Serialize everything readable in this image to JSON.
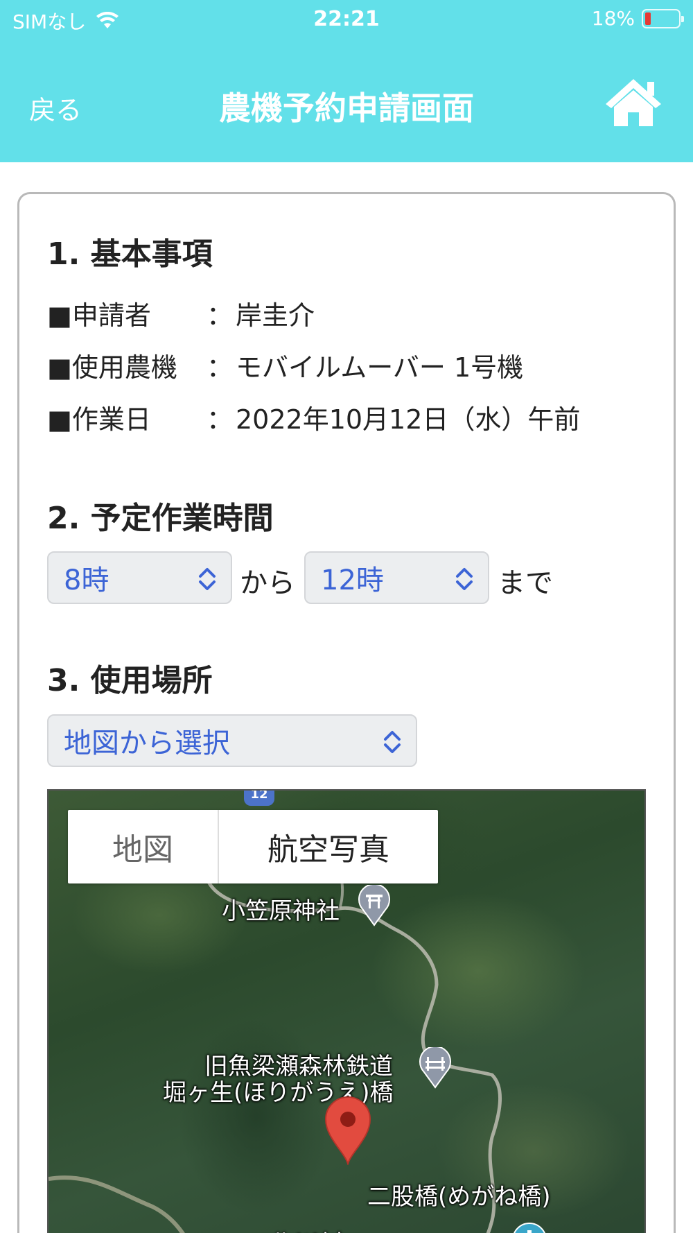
{
  "status_bar": {
    "carrier": "SIMなし",
    "time": "22:21",
    "battery_percent": "18%",
    "battery_level": 0.18,
    "battery_color": "#e53935"
  },
  "nav": {
    "back_label": "戻る",
    "title": "農機予約申請画面",
    "home_icon": "home-icon",
    "background_color": "#62e0e9"
  },
  "section1": {
    "title": "1. 基本事項",
    "rows": [
      {
        "label": "■申請者",
        "colon": "：",
        "value": "岸圭介"
      },
      {
        "label": "■使用農機",
        "colon": "：",
        "value": "モバイルムーバー 1号機"
      },
      {
        "label": "■作業日",
        "colon": "：",
        "value": "2022年10月12日（水）午前"
      }
    ]
  },
  "section2": {
    "title": "2. 予定作業時間",
    "start_select": "8時",
    "from_text": "から",
    "end_select": "12時",
    "until_text": "まで"
  },
  "section3": {
    "title": "3. 使用場所",
    "location_select": "地図から選択",
    "map": {
      "toggle_map": "地図",
      "toggle_aerial": "航空写真",
      "route_number": "12",
      "labels": {
        "shrine": "小笠原神社",
        "railway_line1": "旧魚梁瀬森林鉄道",
        "railway_line2": "堀ヶ生(ほりがうえ)橋",
        "bridge": "二股橋(めがね橋)",
        "village": "北川村"
      }
    }
  },
  "accent_color": "#3c64d6"
}
